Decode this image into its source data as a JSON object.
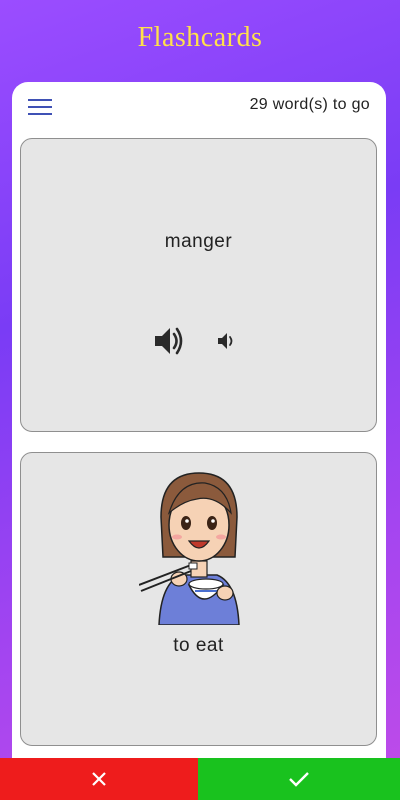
{
  "app": {
    "title": "Flashcards"
  },
  "header": {
    "counter": "29 word(s) to go",
    "menu_icon": "hamburger-menu-icon"
  },
  "card_front": {
    "word": "manger",
    "audio_normal_icon": "speaker-icon",
    "audio_slow_icon": "speaker-small-icon"
  },
  "card_back": {
    "translation": "to eat",
    "image": "person-eating-rice-illustration"
  },
  "actions": {
    "wrong_icon": "x-icon",
    "right_icon": "checkmark-icon",
    "wrong_color": "#ee1c1c",
    "right_color": "#19c21e"
  },
  "colors": {
    "title": "#ffe14a",
    "menu": "#3f51b5",
    "card": "#e6e6e6"
  }
}
